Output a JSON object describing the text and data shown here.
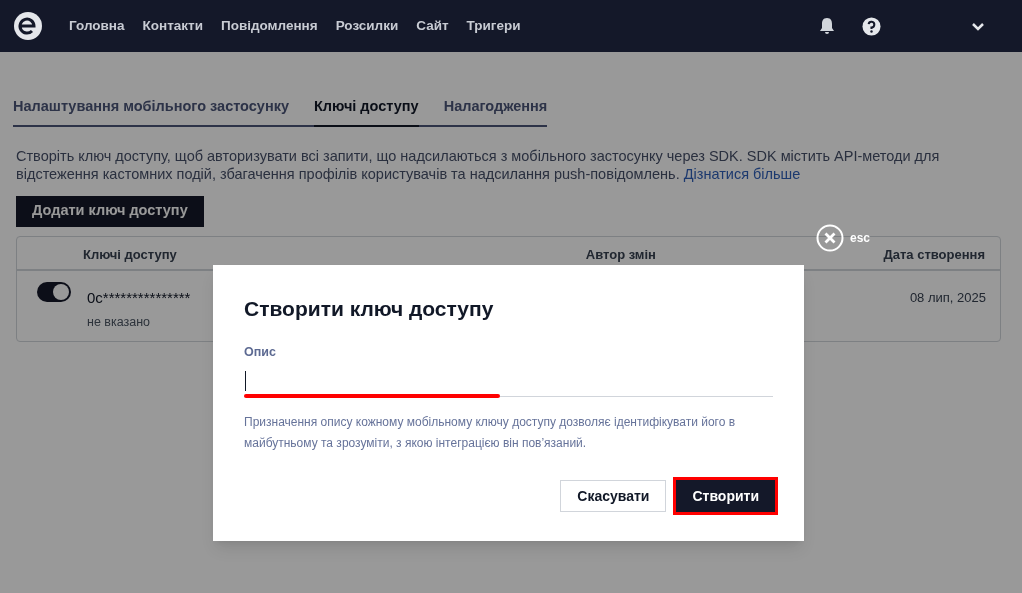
{
  "nav": {
    "items": [
      {
        "label": "Головна"
      },
      {
        "label": "Контакти"
      },
      {
        "label": "Повідомлення"
      },
      {
        "label": "Розсилки"
      },
      {
        "label": "Сайт"
      },
      {
        "label": "Тригери"
      }
    ]
  },
  "tabs": [
    {
      "label": "Налаштування мобільного застосунку",
      "selected": false
    },
    {
      "label": "Ключі доступу",
      "selected": true
    },
    {
      "label": "Налагодження",
      "selected": false
    }
  ],
  "intro": {
    "text": "Створіть ключ доступу, щоб авторизувати всі запити, що надсилаються з мобільного застосунку через SDK. SDK містить API-методи для відстеження кастомних подій, збагачення профілів користувачів та надсилання push-повідомлень.",
    "link": "Дізнатися більше"
  },
  "add_button": "Додати ключ доступу",
  "table": {
    "columns": [
      "Ключі доступу",
      "Автор змін",
      "Дата створення"
    ],
    "rows": [
      {
        "enabled": true,
        "key": "0c***************",
        "description": "не вказано",
        "created": "08 лип, 2025"
      }
    ]
  },
  "modal": {
    "close_label": "esc",
    "title": "Створити ключ доступу",
    "field": {
      "label": "Опис",
      "highlighted": true
    },
    "hint": "Призначення опису кожному мобільному ключу доступу дозволяє ідентифікувати його в майбутньому та зрозуміти, з якою інтеграцією він пов’язаний.",
    "buttons": [
      {
        "kind": "secondary",
        "label": "Скасувати",
        "highlighted": false
      },
      {
        "kind": "primary",
        "label": "Створити",
        "highlighted": true
      }
    ]
  }
}
